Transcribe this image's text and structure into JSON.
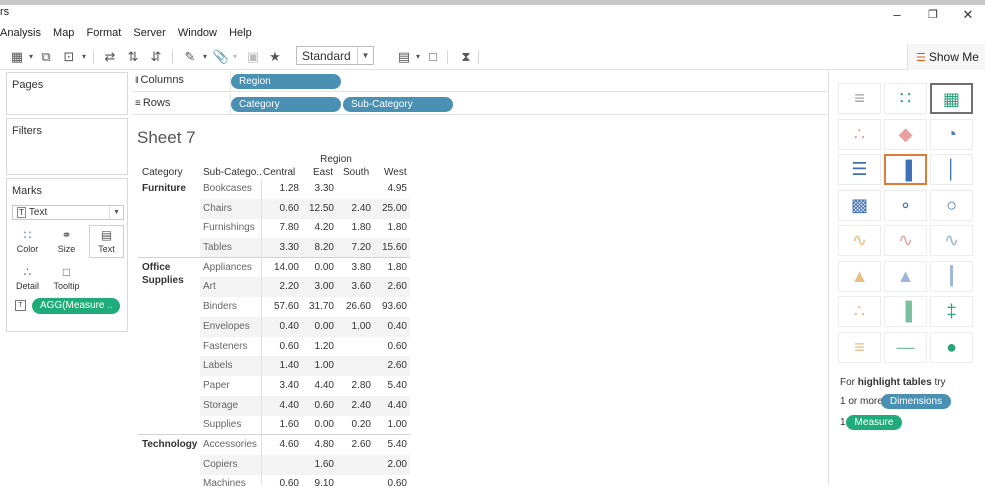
{
  "window": {
    "title_fragment": "rs",
    "minimize": "–",
    "restore": "❐",
    "close": "✕"
  },
  "menu": [
    "Analysis",
    "Map",
    "Format",
    "Server",
    "Window",
    "Help"
  ],
  "toolbar": {
    "fit_label": "Standard",
    "show_me_label": "Show Me"
  },
  "panels": {
    "pages": "Pages",
    "filters": "Filters",
    "marks": "Marks",
    "mark_type": "Text",
    "buttons": [
      {
        "label": "Color",
        "icon": "color-dots-icon"
      },
      {
        "label": "Size",
        "icon": "size-icon"
      },
      {
        "label": "Text",
        "icon": "text-icon"
      },
      {
        "label": "Detail",
        "icon": "detail-icon"
      },
      {
        "label": "Tooltip",
        "icon": "tooltip-icon"
      }
    ],
    "measure_pill": "AGG(Measure ..",
    "measure_icon_glyph": "T"
  },
  "shelves": {
    "columns_label": "Columns",
    "rows_label": "Rows",
    "columns_pills": [
      "Region"
    ],
    "rows_pills": [
      "Category",
      "Sub-Category"
    ]
  },
  "sheet": {
    "title": "Sheet 7",
    "column_group": "Region",
    "headers": {
      "category": "Category",
      "subcategory": "Sub-Catego..",
      "regions": [
        "Central",
        "East",
        "South",
        "West"
      ]
    },
    "groups": [
      {
        "category": "Furniture",
        "rows": [
          {
            "sub": "Bookcases",
            "values": [
              "1.28",
              "3.30",
              "",
              "4.95"
            ]
          },
          {
            "sub": "Chairs",
            "values": [
              "0.60",
              "12.50",
              "2.40",
              "25.00"
            ]
          },
          {
            "sub": "Furnishings",
            "values": [
              "7.80",
              "4.20",
              "1.80",
              "1.80"
            ]
          },
          {
            "sub": "Tables",
            "values": [
              "3.30",
              "8.20",
              "7.20",
              "15.60"
            ]
          }
        ]
      },
      {
        "category": "Office Supplies",
        "rows": [
          {
            "sub": "Appliances",
            "values": [
              "14.00",
              "0.00",
              "3.80",
              "1.80"
            ]
          },
          {
            "sub": "Art",
            "values": [
              "2.20",
              "3.00",
              "3.60",
              "2.60"
            ]
          },
          {
            "sub": "Binders",
            "values": [
              "57.60",
              "31.70",
              "26.60",
              "93.60"
            ]
          },
          {
            "sub": "Envelopes",
            "values": [
              "0.40",
              "0.00",
              "1.00",
              "0.40"
            ]
          },
          {
            "sub": "Fasteners",
            "values": [
              "0.60",
              "1.20",
              "",
              "0.60"
            ]
          },
          {
            "sub": "Labels",
            "values": [
              "1.40",
              "1.00",
              "",
              "2.60"
            ]
          },
          {
            "sub": "Paper",
            "values": [
              "3.40",
              "4.40",
              "2.80",
              "5.40"
            ]
          },
          {
            "sub": "Storage",
            "values": [
              "4.40",
              "0.60",
              "2.40",
              "4.40"
            ]
          },
          {
            "sub": "Supplies",
            "values": [
              "1.60",
              "0.00",
              "0.20",
              "1.00"
            ]
          }
        ]
      },
      {
        "category": "Technology",
        "rows": [
          {
            "sub": "Accessories",
            "values": [
              "4.60",
              "4.80",
              "2.60",
              "5.40"
            ]
          },
          {
            "sub": "Copiers",
            "values": [
              "",
              "1.60",
              "",
              "2.00"
            ]
          },
          {
            "sub": "Machines",
            "values": [
              "0.60",
              "9.10",
              "",
              "0.60"
            ]
          }
        ]
      }
    ]
  },
  "show_me": {
    "hint_prefix": "For ",
    "hint_bold": "highlight tables",
    "hint_suffix": " try",
    "dims_prefix": "1 or more",
    "dims_pill": "Dimensions",
    "meas_prefix": "1",
    "meas_pill": "Measure",
    "colors": {
      "accent": "#e07b39",
      "dimension": "#4a90b2",
      "measure": "#1fab7a"
    }
  }
}
